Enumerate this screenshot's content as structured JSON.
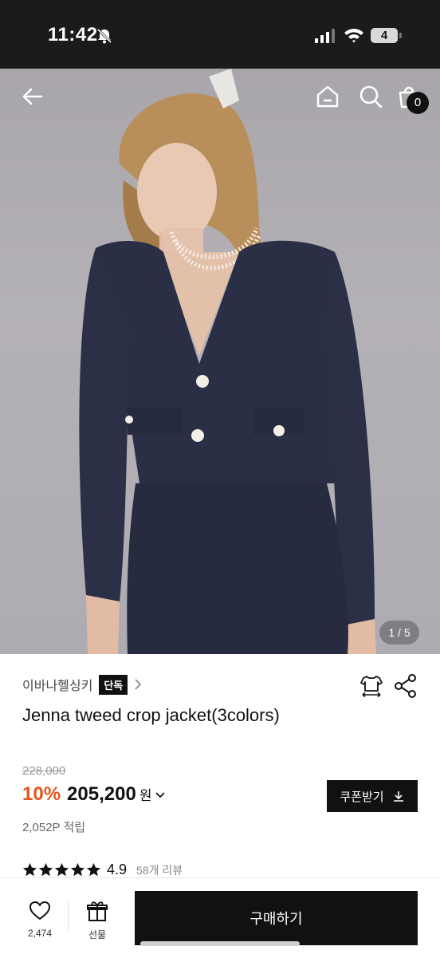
{
  "status": {
    "time": "11:42",
    "battery": "4"
  },
  "header": {
    "cart_count": "0",
    "page_indicator": "1 / 5"
  },
  "product": {
    "brand": "이바나헬싱키",
    "exclusive_badge": "단독",
    "title": "Jenna tweed crop jacket(3colors)",
    "original_price": "228,000",
    "discount": "10%",
    "sale_price": "205,200",
    "currency": "원",
    "points": "2,052P 적립",
    "rating": "4.9",
    "review_count": "58개 리뷰"
  },
  "actions": {
    "coupon_label": "쿠폰받기",
    "like_count": "2,474",
    "gift_label": "선물",
    "buy_label": "구매하기"
  },
  "colors": {
    "accent": "#e5551c",
    "primary": "#111111"
  }
}
